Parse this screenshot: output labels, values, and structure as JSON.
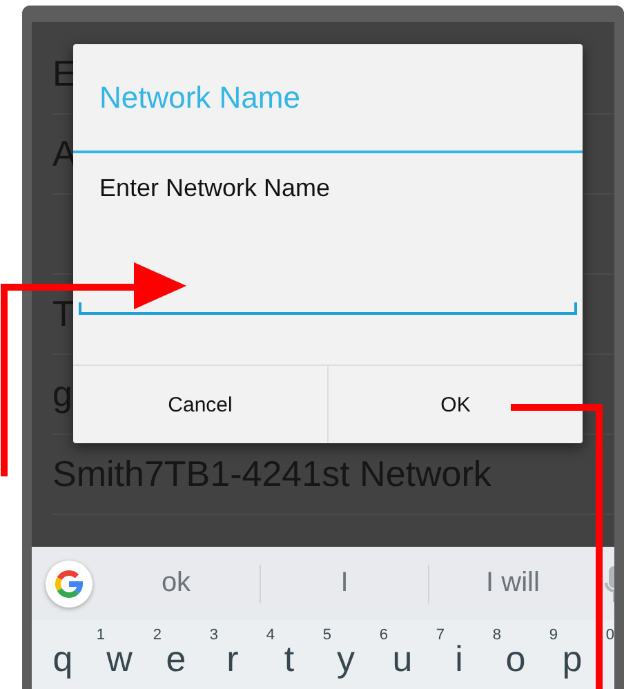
{
  "background_list": {
    "items": [
      {
        "kind": "text",
        "label": "E"
      },
      {
        "kind": "text",
        "label": "A"
      },
      {
        "kind": "covered"
      },
      {
        "kind": "text",
        "label": "T"
      },
      {
        "kind": "text",
        "label": "g"
      },
      {
        "kind": "text",
        "label": "Smith7TB1-4241st Network"
      }
    ]
  },
  "dialog": {
    "title": "Network Name",
    "message": "Enter Network Name",
    "buttons": [
      "Cancel",
      "OK"
    ]
  },
  "keyboard": {
    "suggestions": [
      "ok",
      "I",
      "I will"
    ],
    "keys": [
      {
        "label": "q",
        "hint": "1"
      },
      {
        "label": "w",
        "hint": "2"
      },
      {
        "label": "e",
        "hint": "3"
      },
      {
        "label": "r",
        "hint": "4"
      },
      {
        "label": "t",
        "hint": "5"
      },
      {
        "label": "y",
        "hint": "6"
      },
      {
        "label": "u",
        "hint": "7"
      },
      {
        "label": "i",
        "hint": "8"
      },
      {
        "label": "o",
        "hint": "9"
      },
      {
        "label": "p",
        "hint": "0"
      }
    ]
  },
  "annotations": [
    {
      "kind": "arrow"
    },
    {
      "kind": "line"
    }
  ]
}
